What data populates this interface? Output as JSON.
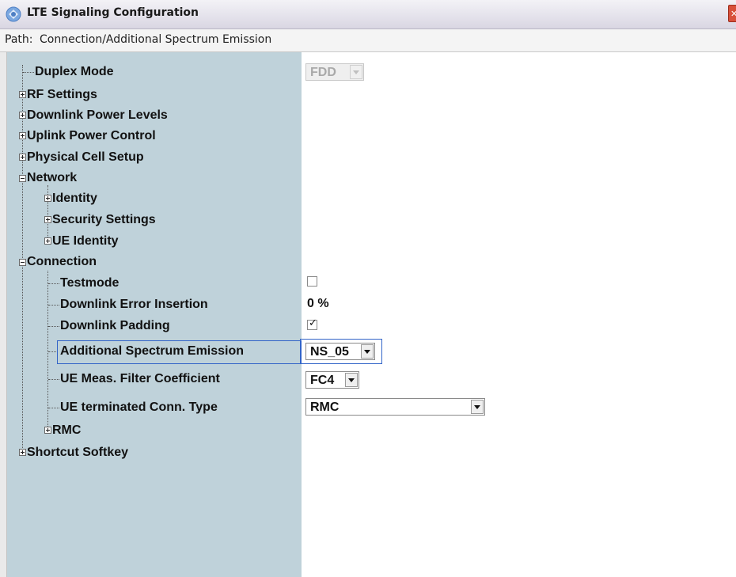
{
  "window": {
    "title": "LTE Signaling Configuration",
    "close_glyph": "✕"
  },
  "path": {
    "label": "Path:",
    "value": "Connection/Additional Spectrum Emission"
  },
  "tree": {
    "items": [
      {
        "label": "Duplex Mode"
      },
      {
        "label": "RF Settings"
      },
      {
        "label": "Downlink Power Levels"
      },
      {
        "label": "Uplink Power Control"
      },
      {
        "label": "Physical Cell Setup"
      },
      {
        "label": "Network"
      },
      {
        "label": "Identity"
      },
      {
        "label": "Security Settings"
      },
      {
        "label": "UE Identity"
      },
      {
        "label": "Connection"
      },
      {
        "label": "Testmode"
      },
      {
        "label": "Downlink Error Insertion"
      },
      {
        "label": "Downlink Padding"
      },
      {
        "label": "Additional Spectrum Emission"
      },
      {
        "label": "UE Meas. Filter Coefficient"
      },
      {
        "label": "UE terminated Conn. Type"
      },
      {
        "label": "RMC"
      },
      {
        "label": "Shortcut Softkey"
      }
    ]
  },
  "values": {
    "duplex_mode": "FDD",
    "testmode_checked": false,
    "downlink_error_insertion": "0 %",
    "downlink_padding_checked": true,
    "additional_spectrum_emission": "NS_05",
    "ue_meas_filter_coefficient": "FC4",
    "ue_terminated_conn_type": "RMC",
    "check_glyph": "✓"
  },
  "colors": {
    "tree_background": "#bfd2da",
    "selection_border": "#3264c8"
  }
}
